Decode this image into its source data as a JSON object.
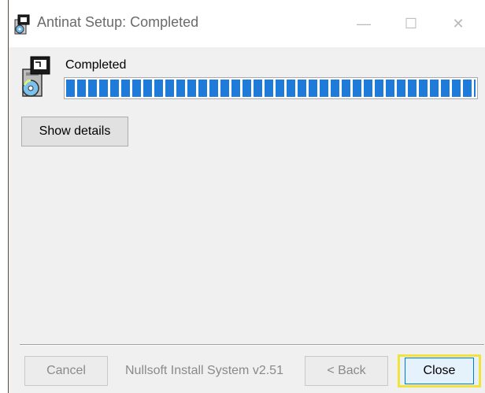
{
  "window": {
    "title": "Antinat Setup: Completed",
    "controls": {
      "minimize": "—",
      "maximize": "☐",
      "close": "✕"
    }
  },
  "status": {
    "label": "Completed",
    "progress_fraction": 1.0
  },
  "buttons": {
    "show_details": "Show details",
    "cancel": "Cancel",
    "back": "< Back",
    "close": "Close"
  },
  "branding": "Nullsoft Install System v2.51",
  "colors": {
    "progress": "#1e7bd9",
    "focus_highlight": "#f2e23c"
  },
  "icons": {
    "title": "installer-package-icon",
    "header": "installer-package-icon"
  }
}
